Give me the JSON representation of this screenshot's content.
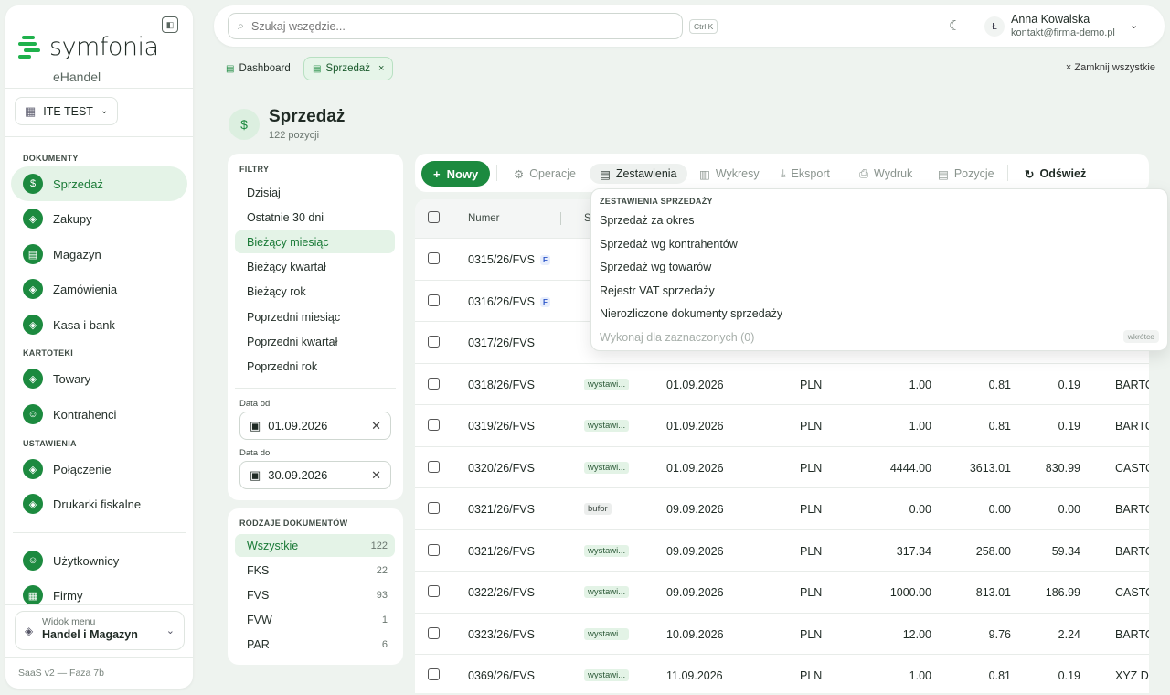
{
  "app": {
    "brand": "symfonia",
    "product": "eHandel",
    "company": "ITE TEST",
    "version": "SaaS v2 — Faza 7b"
  },
  "sidebar": {
    "sections": {
      "docs": "DOKUMENTY",
      "files": "KARTOTEKI",
      "settings": "USTAWIENIA"
    },
    "items": [
      {
        "label": "Sprzedaż",
        "icon": "receipt-icon",
        "active": true
      },
      {
        "label": "Zakupy",
        "icon": "box-icon"
      },
      {
        "label": "Magazyn",
        "icon": "warehouse-icon"
      },
      {
        "label": "Zamówienia",
        "icon": "box-icon"
      },
      {
        "label": "Kasa i bank",
        "icon": "box-icon"
      },
      {
        "label": "Towary",
        "icon": "box-icon"
      },
      {
        "label": "Kontrahenci",
        "icon": "users-icon"
      },
      {
        "label": "Połączenie",
        "icon": "box-icon"
      },
      {
        "label": "Drukarki fiskalne",
        "icon": "box-icon"
      },
      {
        "label": "Użytkownicy",
        "icon": "user-settings-icon"
      },
      {
        "label": "Firmy",
        "icon": "building-icon"
      }
    ],
    "view_menu": {
      "label": "Widok menu",
      "value": "Handel i Magazyn"
    }
  },
  "topbar": {
    "search_placeholder": "Szukaj wszędzie...",
    "shortcut": "Ctrl K",
    "user_initial": "Ł",
    "user_name": "Anna Kowalska",
    "user_email": "kontakt@firma-demo.pl"
  },
  "tabs": [
    {
      "label": "Dashboard"
    },
    {
      "label": "Sprzedaż",
      "active": true
    }
  ],
  "close_all": "Zamknij wszystkie",
  "page": {
    "title": "Sprzedaż",
    "subtitle": "122 pozycji"
  },
  "filters": {
    "title": "FILTRY",
    "items": [
      "Dzisiaj",
      "Ostatnie 30 dni",
      "Bieżący miesiąc",
      "Bieżący kwartał",
      "Bieżący rok",
      "Poprzedni miesiąc",
      "Poprzedni kwartał",
      "Poprzedni rok"
    ],
    "active_index": 2,
    "date_from_label": "Data od",
    "date_from": "01.09.2026",
    "date_to_label": "Data do",
    "date_to": "30.09.2026"
  },
  "doc_types": {
    "title": "RODZAJE DOKUMENTÓW",
    "items": [
      {
        "label": "Wszystkie",
        "count": "122",
        "active": true
      },
      {
        "label": "FKS",
        "count": "22"
      },
      {
        "label": "FVS",
        "count": "93"
      },
      {
        "label": "FVW",
        "count": "1"
      },
      {
        "label": "PAR",
        "count": "6"
      }
    ]
  },
  "toolbar": {
    "new": "Nowy",
    "operations": "Operacje",
    "reports": "Zestawienia",
    "charts": "Wykresy",
    "export": "Eksport",
    "print": "Wydruk",
    "positions": "Pozycje",
    "refresh": "Odśwież"
  },
  "table": {
    "headers": {
      "number": "Numer",
      "status": "S"
    },
    "rows": [
      {
        "number": "0315/26/FVS",
        "flag": "F",
        "status": "",
        "date": "",
        "currency": "",
        "gross": "",
        "net": "",
        "vat": "",
        "client": ""
      },
      {
        "number": "0316/26/FVS",
        "flag": "F",
        "status": "",
        "date": "",
        "currency": "",
        "gross": "",
        "net": "",
        "vat": "",
        "client": ""
      },
      {
        "number": "0317/26/FVS",
        "flag": "",
        "status": "",
        "date": "",
        "currency": "",
        "gross": "",
        "net": "",
        "vat": "",
        "client": ""
      },
      {
        "number": "0318/26/FVS",
        "flag": "",
        "status": "wystawi...",
        "date": "01.09.2026",
        "currency": "PLN",
        "gross": "1.00",
        "net": "0.81",
        "vat": "0.19",
        "client": "BARTO"
      },
      {
        "number": "0319/26/FVS",
        "flag": "",
        "status": "wystawi...",
        "date": "01.09.2026",
        "currency": "PLN",
        "gross": "1.00",
        "net": "0.81",
        "vat": "0.19",
        "client": "BARTO"
      },
      {
        "number": "0320/26/FVS",
        "flag": "",
        "status": "wystawi...",
        "date": "01.09.2026",
        "currency": "PLN",
        "gross": "4444.00",
        "net": "3613.01",
        "vat": "830.99",
        "client": "CASTO"
      },
      {
        "number": "0321/26/FVS",
        "flag": "",
        "status": "bufor",
        "date": "09.09.2026",
        "currency": "PLN",
        "gross": "0.00",
        "net": "0.00",
        "vat": "0.00",
        "client": "BARTO"
      },
      {
        "number": "0321/26/FVS",
        "flag": "",
        "status": "wystawi...",
        "date": "09.09.2026",
        "currency": "PLN",
        "gross": "317.34",
        "net": "258.00",
        "vat": "59.34",
        "client": "BARTO"
      },
      {
        "number": "0322/26/FVS",
        "flag": "",
        "status": "wystawi...",
        "date": "09.09.2026",
        "currency": "PLN",
        "gross": "1000.00",
        "net": "813.01",
        "vat": "186.99",
        "client": "CASTO"
      },
      {
        "number": "0323/26/FVS",
        "flag": "",
        "status": "wystawi...",
        "date": "10.09.2026",
        "currency": "PLN",
        "gross": "12.00",
        "net": "9.76",
        "vat": "2.24",
        "client": "BARTO"
      },
      {
        "number": "0369/26/FVS",
        "flag": "",
        "status": "wystawi...",
        "date": "11.09.2026",
        "currency": "PLN",
        "gross": "1.00",
        "net": "0.81",
        "vat": "0.19",
        "client": "XYZ De"
      }
    ]
  },
  "dropdown": {
    "title": "ZESTAWIENIA SPRZEDAŻY",
    "items": [
      "Sprzedaż za okres",
      "Sprzedaż wg kontrahentów",
      "Sprzedaż wg towarów",
      "Rejestr VAT sprzedaży",
      "Nierozliczone dokumenty sprzedaży"
    ],
    "disabled_item": "Wykonaj dla zaznaczonych (0)",
    "soon": "wkrótce"
  },
  "colors": {
    "accent": "#1c8a3f",
    "accent_light": "#e4f3e7"
  }
}
